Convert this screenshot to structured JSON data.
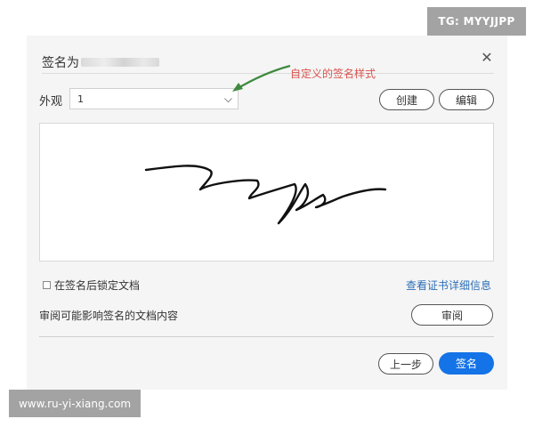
{
  "watermarks": {
    "top": "TG: MYYJJPP",
    "bottom": "www.ru-yi-xiang.com"
  },
  "dialog": {
    "title": "签名为",
    "appearance": {
      "label": "外观",
      "selected": "1"
    },
    "annotation": "自定义的签名样式",
    "buttons": {
      "create": "创建",
      "edit": "编辑",
      "review": "审阅",
      "prev": "上一步",
      "sign": "签名"
    },
    "lock_label": "在签名后锁定文档",
    "cert_link": "查看证书详细信息",
    "review_text": "审阅可能影响签名的文档内容"
  },
  "colors": {
    "primary": "#1473e6",
    "link": "#2d6fb8",
    "annotation": "#d9534f",
    "arrow": "#3f8a3f"
  },
  "icons": {
    "close": "close-icon",
    "dropdown": "chevron-down-icon"
  }
}
